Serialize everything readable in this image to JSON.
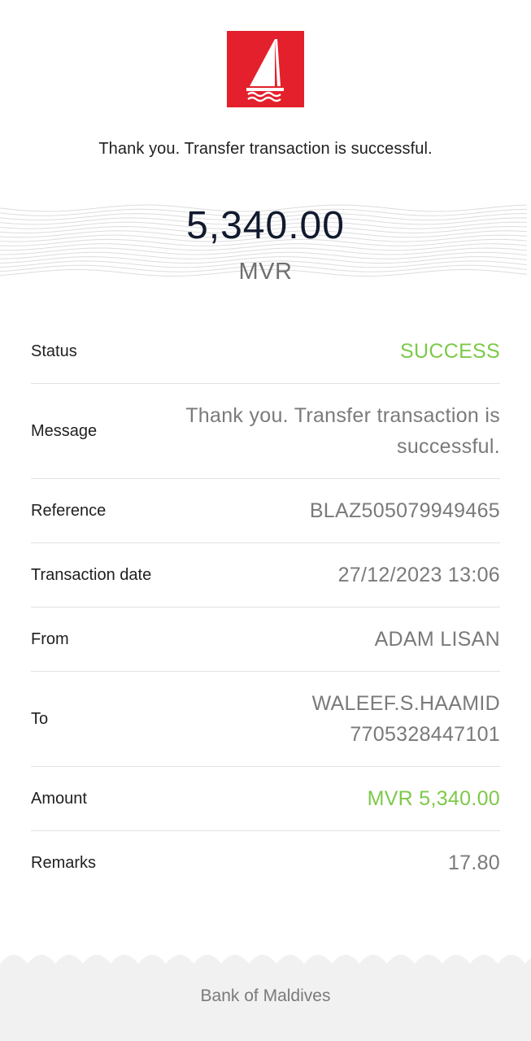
{
  "brand": {
    "logo_icon": "sailboat-icon",
    "logo_color": "#e3202b"
  },
  "headline": "Thank you. Transfer transaction is successful.",
  "amount": {
    "value": "5,340.00",
    "currency": "MVR"
  },
  "details": {
    "status": {
      "label": "Status",
      "value": "SUCCESS"
    },
    "message": {
      "label": "Message",
      "line1": "Thank you. Transfer transaction is",
      "line2": "successful."
    },
    "reference": {
      "label": "Reference",
      "value": "BLAZ505079949465"
    },
    "transaction_date": {
      "label": "Transaction date",
      "value": "27/12/2023 13:06"
    },
    "from": {
      "label": "From",
      "value": "ADAM LISAN"
    },
    "to": {
      "label": "To",
      "name": "WALEEF.S.HAAMID",
      "account": "7705328447101"
    },
    "amount": {
      "label": "Amount",
      "value": "MVR 5,340.00"
    },
    "remarks": {
      "label": "Remarks",
      "value": "17.80"
    }
  },
  "footer": {
    "text": "Bank of Maldives"
  },
  "colors": {
    "success": "#7dc94a",
    "amount_text": "#111a2e",
    "footer_bg": "#f1f1f1"
  }
}
